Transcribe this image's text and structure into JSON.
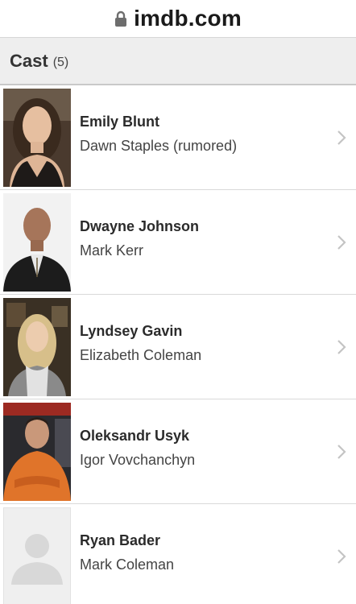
{
  "browser": {
    "url": "imdb.com",
    "lock_icon": "lock-icon"
  },
  "cast_header": {
    "title": "Cast",
    "count": "(5)"
  },
  "cast": [
    {
      "name": "Emily Blunt",
      "role": "Dawn Staples (rumored)",
      "photo": "photo"
    },
    {
      "name": "Dwayne Johnson",
      "role": "Mark Kerr",
      "photo": "photo"
    },
    {
      "name": "Lyndsey Gavin",
      "role": "Elizabeth Coleman",
      "photo": "photo"
    },
    {
      "name": "Oleksandr Usyk",
      "role": "Igor Vovchanchyn",
      "photo": "photo"
    },
    {
      "name": "Ryan Bader",
      "role": "Mark Coleman",
      "photo": "placeholder-avatar"
    }
  ],
  "icons": {
    "row_arrow": "chevron-right-icon"
  }
}
